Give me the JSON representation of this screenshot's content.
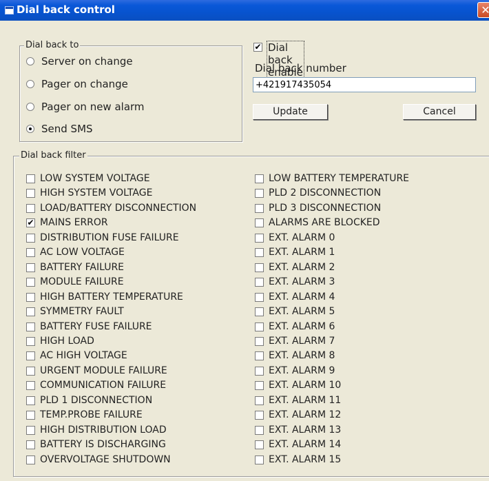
{
  "window": {
    "title": "Dial back control",
    "close_glyph": "✕",
    "icon": "window-app-icon"
  },
  "dial_back_to": {
    "legend": "Dial back to",
    "options": [
      {
        "label": "Server on change",
        "selected": false
      },
      {
        "label": "Pager on change",
        "selected": false
      },
      {
        "label": "Pager on new alarm",
        "selected": false
      },
      {
        "label": "Send SMS",
        "selected": true
      }
    ]
  },
  "dial_back_enable": {
    "label": "Dial back enable",
    "checked": true
  },
  "dial_back_number": {
    "label": "Dial back number",
    "value": "+421917435054"
  },
  "buttons": {
    "update": "Update",
    "cancel": "Cancel"
  },
  "filter": {
    "legend": "Dial back filter",
    "left": [
      {
        "label": "LOW SYSTEM VOLTAGE",
        "checked": false
      },
      {
        "label": "HIGH SYSTEM VOLTAGE",
        "checked": false
      },
      {
        "label": "LOAD/BATTERY DISCONNECTION",
        "checked": false
      },
      {
        "label": "MAINS ERROR",
        "checked": true
      },
      {
        "label": "DISTRIBUTION FUSE FAILURE",
        "checked": false
      },
      {
        "label": "AC LOW VOLTAGE",
        "checked": false
      },
      {
        "label": "BATTERY FAILURE",
        "checked": false
      },
      {
        "label": "MODULE FAILURE",
        "checked": false
      },
      {
        "label": "HIGH BATTERY TEMPERATURE",
        "checked": false
      },
      {
        "label": "SYMMETRY FAULT",
        "checked": false
      },
      {
        "label": "BATTERY FUSE FAILURE",
        "checked": false
      },
      {
        "label": "HIGH LOAD",
        "checked": false
      },
      {
        "label": "AC HIGH VOLTAGE",
        "checked": false
      },
      {
        "label": "URGENT MODULE FAILURE",
        "checked": false
      },
      {
        "label": "COMMUNICATION FAILURE",
        "checked": false
      },
      {
        "label": "PLD 1 DISCONNECTION",
        "checked": false
      },
      {
        "label": "TEMP.PROBE FAILURE",
        "checked": false
      },
      {
        "label": "HIGH DISTRIBUTION LOAD",
        "checked": false
      },
      {
        "label": "BATTERY IS DISCHARGING",
        "checked": false
      },
      {
        "label": "OVERVOLTAGE SHUTDOWN",
        "checked": false
      }
    ],
    "right": [
      {
        "label": "LOW BATTERY TEMPERATURE",
        "checked": false
      },
      {
        "label": "PLD 2 DISCONNECTION",
        "checked": false
      },
      {
        "label": "PLD 3 DISCONNECTION",
        "checked": false
      },
      {
        "label": "ALARMS ARE BLOCKED",
        "checked": false
      },
      {
        "label": "EXT. ALARM 0",
        "checked": false
      },
      {
        "label": "EXT. ALARM 1",
        "checked": false
      },
      {
        "label": "EXT. ALARM 2",
        "checked": false
      },
      {
        "label": "EXT. ALARM 3",
        "checked": false
      },
      {
        "label": "EXT. ALARM 4",
        "checked": false
      },
      {
        "label": "EXT. ALARM 5",
        "checked": false
      },
      {
        "label": "EXT. ALARM 6",
        "checked": false
      },
      {
        "label": "EXT. ALARM 7",
        "checked": false
      },
      {
        "label": "EXT. ALARM 8",
        "checked": false
      },
      {
        "label": "EXT. ALARM 9",
        "checked": false
      },
      {
        "label": "EXT. ALARM 10",
        "checked": false
      },
      {
        "label": "EXT. ALARM 11",
        "checked": false
      },
      {
        "label": "EXT. ALARM 12",
        "checked": false
      },
      {
        "label": "EXT. ALARM 13",
        "checked": false
      },
      {
        "label": "EXT. ALARM 14",
        "checked": false
      },
      {
        "label": "EXT. ALARM 15",
        "checked": false
      }
    ]
  }
}
